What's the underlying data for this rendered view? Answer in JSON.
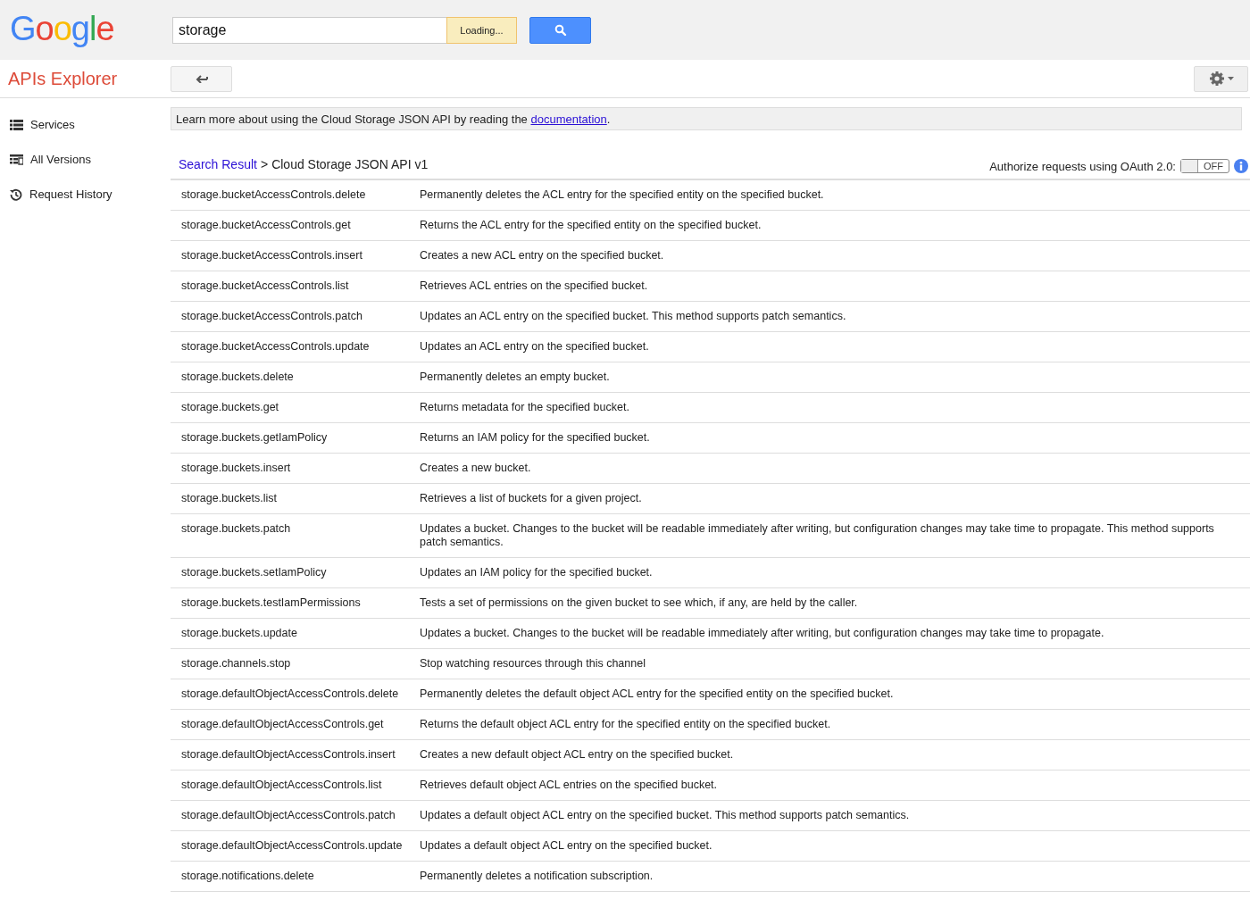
{
  "logo": "Google",
  "search": {
    "value": "storage",
    "status": "Loading..."
  },
  "app_title": "APIs Explorer",
  "sidebar": {
    "items": [
      {
        "label": "Services",
        "kind": "list"
      },
      {
        "label": "All Versions",
        "kind": "versions"
      },
      {
        "label": "Request History",
        "kind": "history"
      }
    ]
  },
  "notice": {
    "text": "Learn more about using the Cloud Storage JSON API by reading the ",
    "link": "documentation",
    "end": "."
  },
  "breadcrumb": {
    "link": "Search Result",
    "separator": ">",
    "current": "Cloud Storage JSON API v1"
  },
  "oauth": {
    "label": "Authorize requests using OAuth 2.0:",
    "on": false,
    "toggle_text": "OFF"
  },
  "methods": [
    {
      "name": "storage.bucketAccessControls.delete",
      "description": "Permanently deletes the ACL entry for the specified entity on the specified bucket."
    },
    {
      "name": "storage.bucketAccessControls.get",
      "description": "Returns the ACL entry for the specified entity on the specified bucket."
    },
    {
      "name": "storage.bucketAccessControls.insert",
      "description": "Creates a new ACL entry on the specified bucket."
    },
    {
      "name": "storage.bucketAccessControls.list",
      "description": "Retrieves ACL entries on the specified bucket."
    },
    {
      "name": "storage.bucketAccessControls.patch",
      "description": "Updates an ACL entry on the specified bucket. This method supports patch semantics."
    },
    {
      "name": "storage.bucketAccessControls.update",
      "description": "Updates an ACL entry on the specified bucket."
    },
    {
      "name": "storage.buckets.delete",
      "description": "Permanently deletes an empty bucket."
    },
    {
      "name": "storage.buckets.get",
      "description": "Returns metadata for the specified bucket."
    },
    {
      "name": "storage.buckets.getIamPolicy",
      "description": "Returns an IAM policy for the specified bucket."
    },
    {
      "name": "storage.buckets.insert",
      "description": "Creates a new bucket."
    },
    {
      "name": "storage.buckets.list",
      "description": "Retrieves a list of buckets for a given project."
    },
    {
      "name": "storage.buckets.patch",
      "description": "Updates a bucket. Changes to the bucket will be readable immediately after writing, but configuration changes may take time to propagate. This method supports patch semantics."
    },
    {
      "name": "storage.buckets.setIamPolicy",
      "description": "Updates an IAM policy for the specified bucket."
    },
    {
      "name": "storage.buckets.testIamPermissions",
      "description": "Tests a set of permissions on the given bucket to see which, if any, are held by the caller."
    },
    {
      "name": "storage.buckets.update",
      "description": "Updates a bucket. Changes to the bucket will be readable immediately after writing, but configuration changes may take time to propagate."
    },
    {
      "name": "storage.channels.stop",
      "description": "Stop watching resources through this channel"
    },
    {
      "name": "storage.defaultObjectAccessControls.delete",
      "description": "Permanently deletes the default object ACL entry for the specified entity on the specified bucket."
    },
    {
      "name": "storage.defaultObjectAccessControls.get",
      "description": "Returns the default object ACL entry for the specified entity on the specified bucket."
    },
    {
      "name": "storage.defaultObjectAccessControls.insert",
      "description": "Creates a new default object ACL entry on the specified bucket."
    },
    {
      "name": "storage.defaultObjectAccessControls.list",
      "description": "Retrieves default object ACL entries on the specified bucket."
    },
    {
      "name": "storage.defaultObjectAccessControls.patch",
      "description": "Updates a default object ACL entry on the specified bucket. This method supports patch semantics."
    },
    {
      "name": "storage.defaultObjectAccessControls.update",
      "description": "Updates a default object ACL entry on the specified bucket."
    },
    {
      "name": "storage.notifications.delete",
      "description": "Permanently deletes a notification subscription."
    }
  ]
}
